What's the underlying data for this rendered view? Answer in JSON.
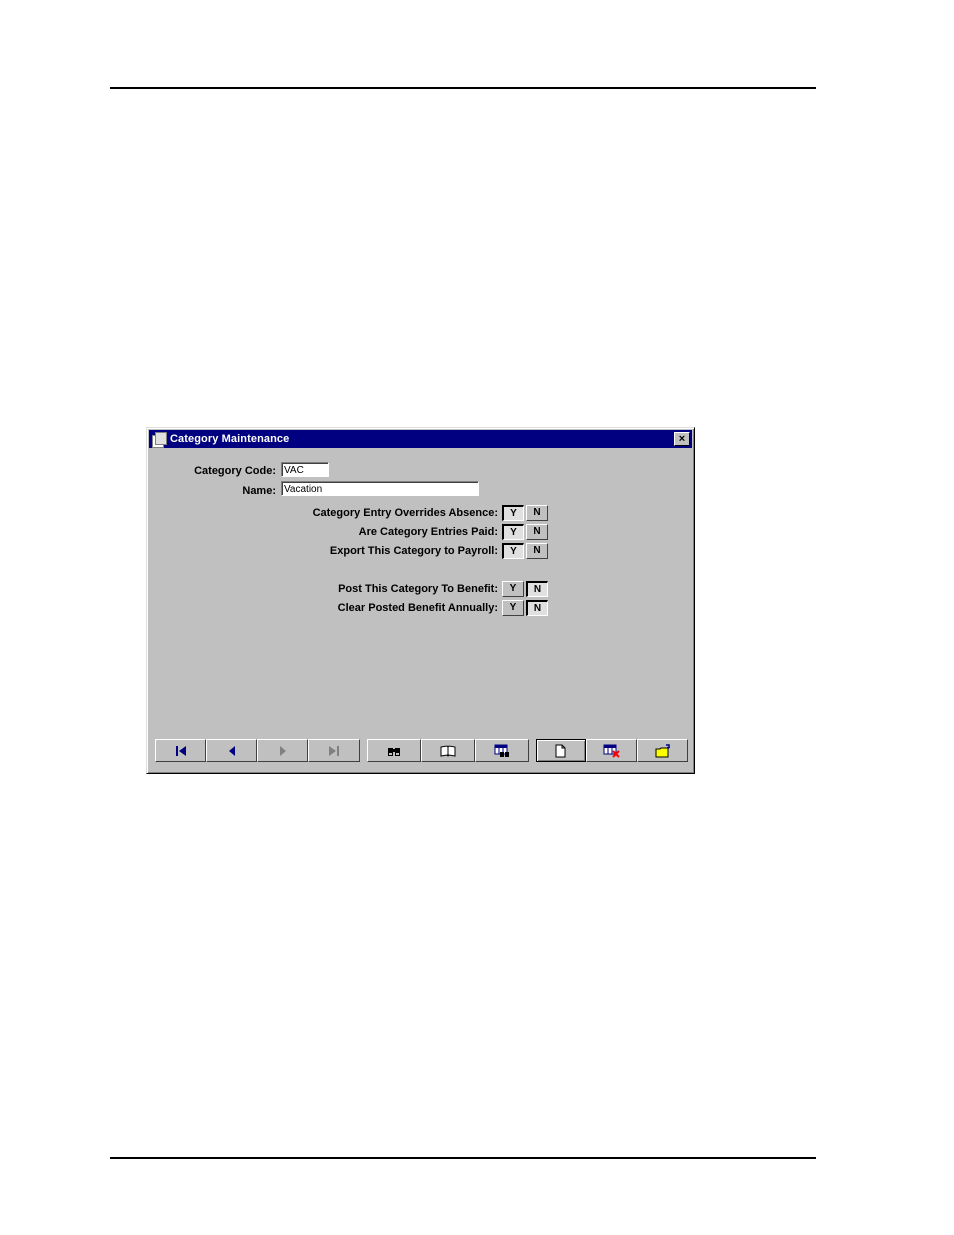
{
  "window": {
    "title": "Category Maintenance",
    "close_label": "×"
  },
  "form": {
    "category_code": {
      "label": "Category Code:",
      "value": "VAC"
    },
    "name": {
      "label": "Name:",
      "value": "Vacation"
    },
    "toggles": [
      {
        "label": "Category Entry Overrides Absence:",
        "selected": "Y"
      },
      {
        "label": "Are Category Entries Paid:",
        "selected": "Y"
      },
      {
        "label": "Export This Category to Payroll:",
        "selected": "Y"
      },
      {
        "label": "Post This Category To Benefit:",
        "selected": "N"
      },
      {
        "label": "Clear Posted Benefit Annually:",
        "selected": "N"
      }
    ],
    "yes_label": "Y",
    "no_label": "N"
  },
  "toolbar": {
    "nav_icons": [
      "first-record-icon",
      "previous-record-icon",
      "next-record-icon",
      "last-record-icon"
    ],
    "tool_icons": [
      "binoculars-icon",
      "book-icon",
      "grid-find-icon"
    ],
    "action_icons": [
      "new-page-icon",
      "delete-record-icon",
      "open-folder-icon"
    ]
  },
  "colors": {
    "title_bar": "#000080",
    "window_bg": "#c0c0c0",
    "nav_arrow_active": "#000080",
    "nav_arrow_disabled": "#808080",
    "delete_accent": "#ff0000",
    "folder": "#ffff00"
  }
}
